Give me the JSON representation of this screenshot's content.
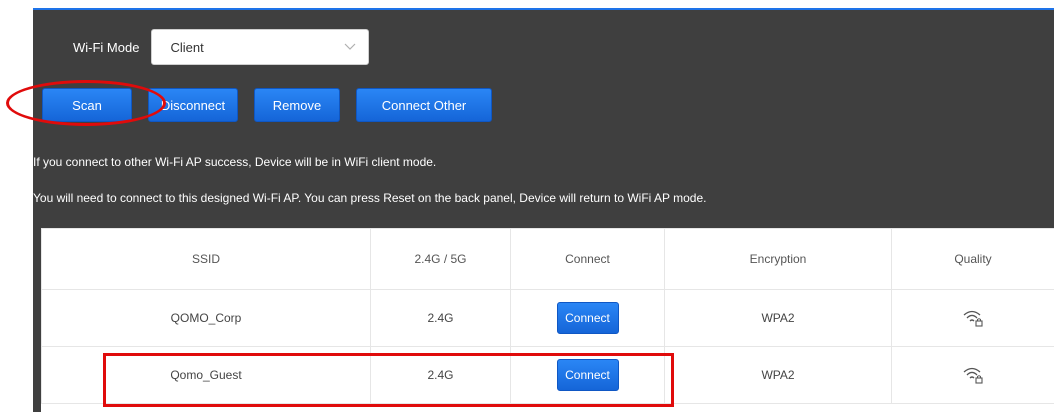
{
  "wifi_mode": {
    "label": "Wi-Fi Mode",
    "selected": "Client"
  },
  "toolbar": {
    "scan_label": "Scan",
    "disconnect_label": "Disconnect",
    "remove_label": "Remove",
    "connect_other_label": "Connect Other"
  },
  "info": {
    "line1": "If you connect to other Wi-Fi AP success, Device will be in WiFi client mode.",
    "line2": "You will need to connect to this designed Wi-Fi AP. You can press Reset on the back panel, Device will return to WiFi AP mode."
  },
  "table": {
    "headers": [
      "SSID",
      "2.4G / 5G",
      "Connect",
      "Encryption",
      "Quality"
    ],
    "rows": [
      {
        "ssid": "QOMO_Corp",
        "band": "2.4G",
        "connect_label": "Connect",
        "encryption": "WPA2",
        "quality_icon": "wifi-lock-icon"
      },
      {
        "ssid": "Qomo_Guest",
        "band": "2.4G",
        "connect_label": "Connect",
        "encryption": "WPA2",
        "quality_icon": "wifi-lock-icon"
      }
    ]
  },
  "colors": {
    "panel_bg": "#3f3f3f",
    "button_blue": "#1e73e8",
    "annotation_red": "#e00b0b"
  }
}
